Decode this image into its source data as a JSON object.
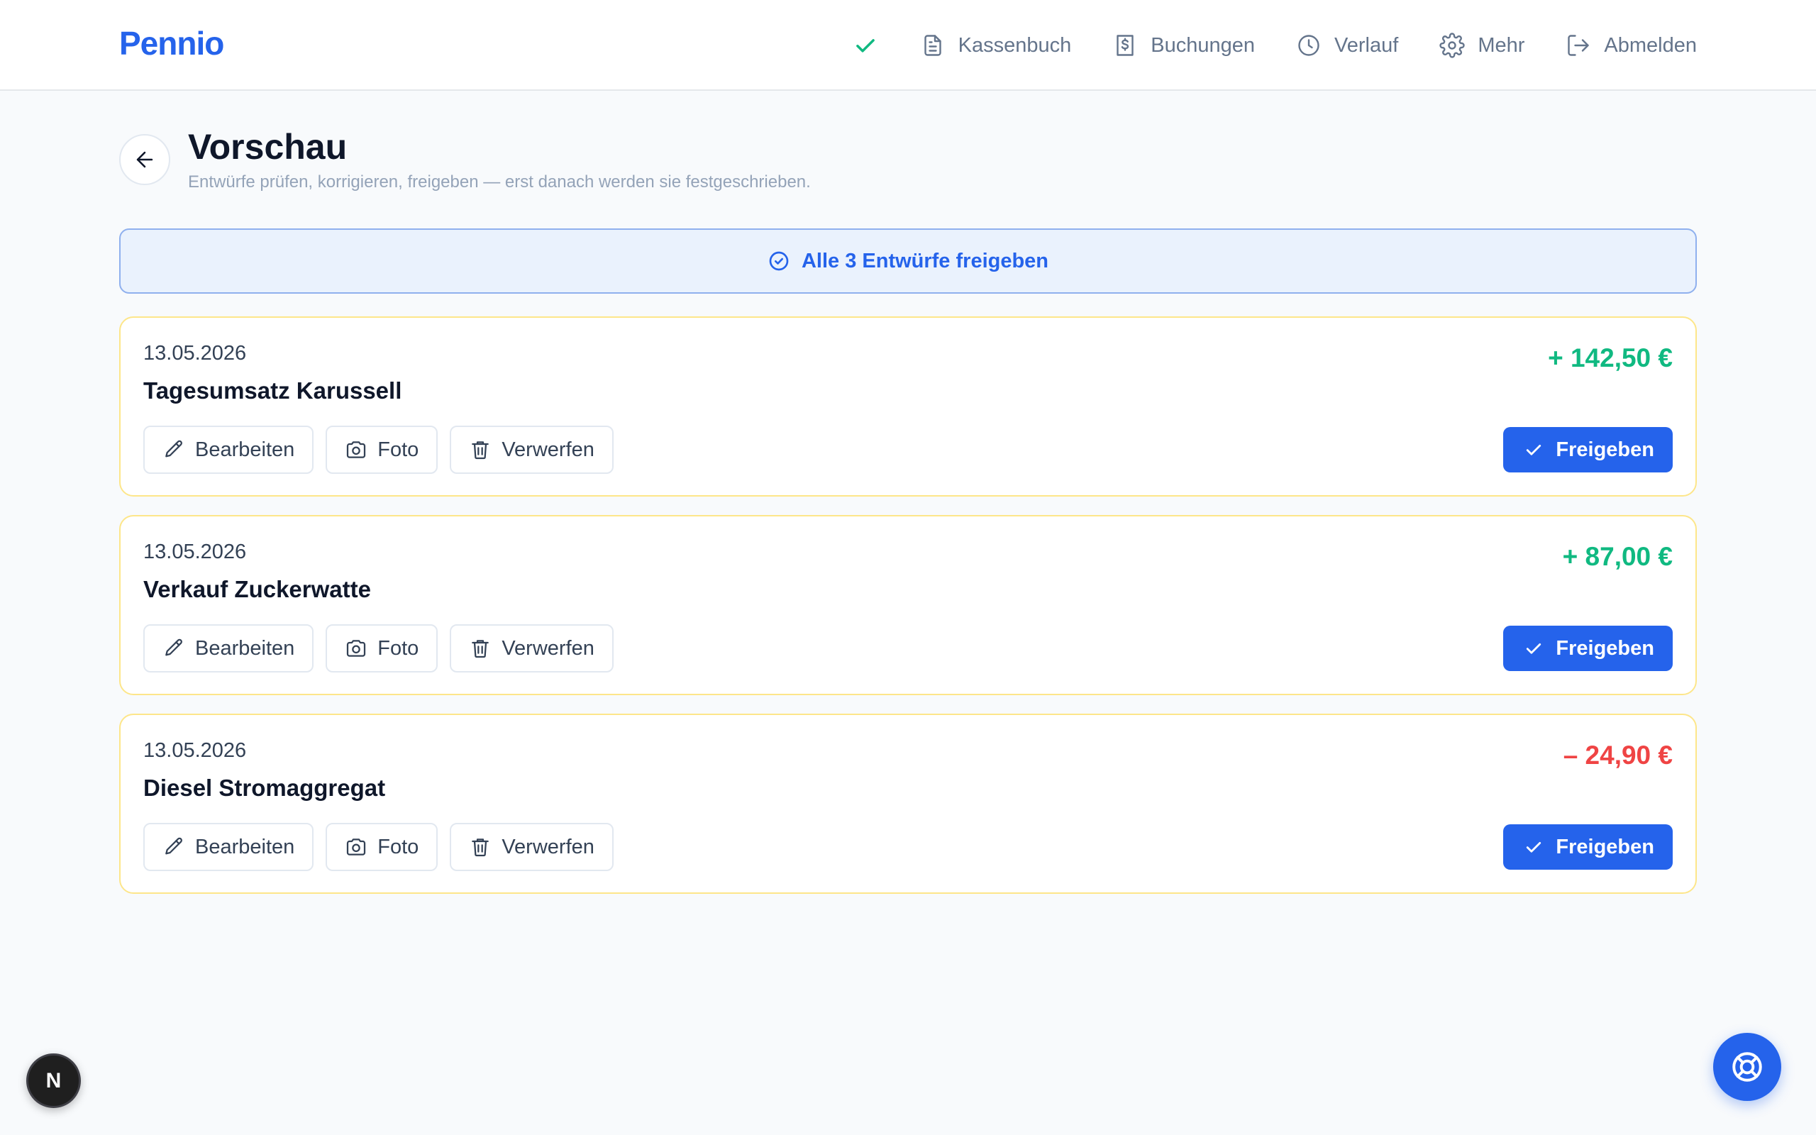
{
  "header": {
    "brand": "Pennio",
    "nav": [
      {
        "label": "Kassenbuch",
        "icon": "document-icon"
      },
      {
        "label": "Buchungen",
        "icon": "receipt-dollar-icon"
      },
      {
        "label": "Verlauf",
        "icon": "clock-icon"
      },
      {
        "label": "Mehr",
        "icon": "gear-icon"
      },
      {
        "label": "Abmelden",
        "icon": "logout-icon"
      }
    ]
  },
  "page": {
    "title": "Vorschau",
    "subtitle": "Entwürfe prüfen, korrigieren, freigeben — erst danach werden sie festgeschrieben."
  },
  "approve_all_label": "Alle 3 Entwürfe freigeben",
  "drafts": [
    {
      "date": "13.05.2026",
      "title": "Tagesumsatz Karussell",
      "amount": "+ 142,50 €",
      "direction": "income"
    },
    {
      "date": "13.05.2026",
      "title": "Verkauf Zuckerwatte",
      "amount": "+ 87,00 €",
      "direction": "income"
    },
    {
      "date": "13.05.2026",
      "title": "Diesel Stromaggregat",
      "amount": "– 24,90 €",
      "direction": "expense"
    }
  ],
  "actions": {
    "edit": "Bearbeiten",
    "photo": "Foto",
    "discard": "Verwerfen",
    "approve": "Freigeben"
  },
  "dev_badge": "N",
  "colors": {
    "accent": "#2563eb",
    "income": "#10b981",
    "expense": "#ef4444",
    "card_border": "#fde68a"
  }
}
